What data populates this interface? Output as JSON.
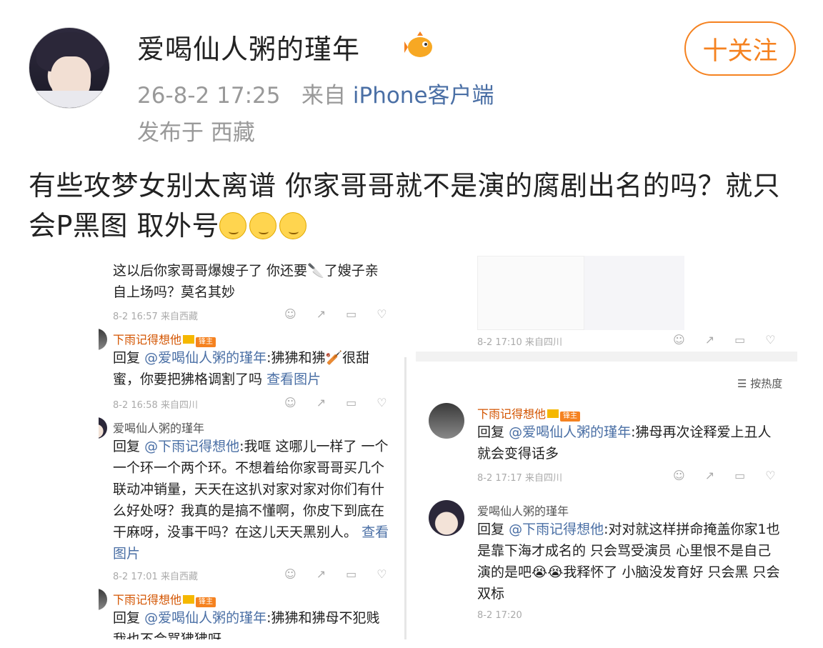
{
  "post": {
    "username": "爱喝仙人粥的瑾年",
    "time": "26-8-2 17:25",
    "from_prefix": "来自",
    "source": "iPhone客户端",
    "location_prefix": "发布于",
    "location": "西藏",
    "follow_label": "十关注",
    "text": "有些攻梦女别太离谱 你家哥哥就不是演的腐剧出名的吗？就只会P黑图 取外号"
  },
  "screenshot_left": {
    "c1_text": "这以后你家哥哥爆嫂子了 你还要🔪了嫂子亲自上场吗？莫名其妙",
    "c1_time": "8-2 16:57 来自西藏",
    "c2_user": "下雨记得想他",
    "c2_badge": "锋主",
    "c2_reply": "回复",
    "c2_at": "@爱喝仙人粥的瑾年",
    "c2_text": ":狒狒和狒🏏很甜蜜，你要把狒格调割了吗",
    "c2_link": "查看图片",
    "c2_time": "8-2 16:58 来自四川",
    "c3_user": "爱喝仙人粥的瑾年",
    "c3_reply": "回复",
    "c3_at": "@下雨记得想他",
    "c3_text": ":我哐 这哪儿一样了 一个一个环一个两个环。不想着给你家哥哥买几个联动冲销量，天天在这扒对家对家对你们有什么好处呀？我真的是搞不懂啊，你皮下到底在干麻呀，没事干吗？在这儿天天黑别人。",
    "c3_link": "查看图片",
    "c3_time": "8-2 17:01 来自西藏",
    "c4_user": "下雨记得想他",
    "c4_badge": "锋主",
    "c4_reply": "回复",
    "c4_at": "@爱喝仙人粥的瑾年",
    "c4_text": ":狒狒和狒母不犯贱我也不会骂狒狒呀"
  },
  "screenshot_right": {
    "top_time": "8-2 17:10 来自四川",
    "sort_label": "按热度",
    "r1_user": "下雨记得想他",
    "r1_badge": "锋主",
    "r1_reply": "回复",
    "r1_at": "@爱喝仙人粥的瑾年",
    "r1_text": ":狒母再次诠释爱上丑人就会变得话多",
    "r1_time": "8-2 17:17 来自四川",
    "r2_user": "爱喝仙人粥的瑾年",
    "r2_reply": "回复",
    "r2_at": "@下雨记得想他",
    "r2_text": ":对对就这样拼命掩盖你家1也是靠下海才成名的 只会骂受演员 心里恨不是自己演的是吧😭😭我释怀了 小脑没发育好 只会黑 只会双标",
    "r2_time": "8-2 17:20"
  },
  "colors": {
    "accent": "#f58220",
    "link": "#4a6fa5",
    "meta": "#999999"
  }
}
